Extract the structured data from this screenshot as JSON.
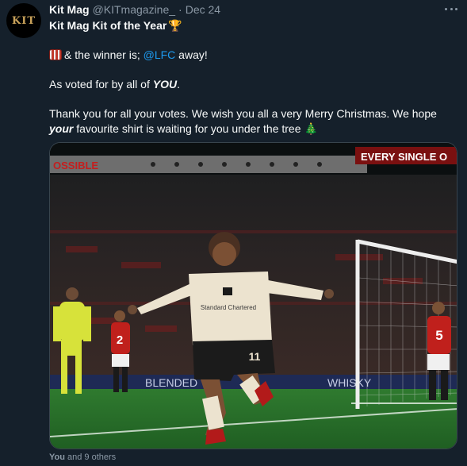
{
  "tweet": {
    "author_name": "Kit Mag",
    "author_handle": "@KITmagazine_",
    "separator": "·",
    "date": "Dec 24",
    "avatar_text": "KIT",
    "title": "Kit Mag Kit of the Year",
    "line2_pre": "& the winner is; ",
    "mention": "@LFC",
    "line2_post": " away!",
    "line3_pre": "As voted for by all of ",
    "line3_em": "YOU",
    "line3_post": ".",
    "line4": "Thank you for all your votes. We wish you all a very Merry Christmas. We hope",
    "line5_em": "your",
    "line5_post": " favourite shirt is waiting for you under the tree",
    "emoji_trophy": "🏆",
    "emoji_tree": "🎄"
  },
  "media": {
    "banner_left": "OSSIBLE",
    "banner_right": "EVERY SINGLE O",
    "board_text": "BLENDED",
    "board_text2": "WHISKY",
    "shirt_number": "11",
    "opponent_number_left": "2",
    "opponent_number_right": "5",
    "shirt_sponsor": "Standard Chartered"
  },
  "footer": {
    "you": "You",
    "others": " and 9 others"
  },
  "colors": {
    "background": "#15202b",
    "text": "#f7f9f9",
    "secondary": "#8b98a5",
    "link": "#1d9bf0"
  }
}
